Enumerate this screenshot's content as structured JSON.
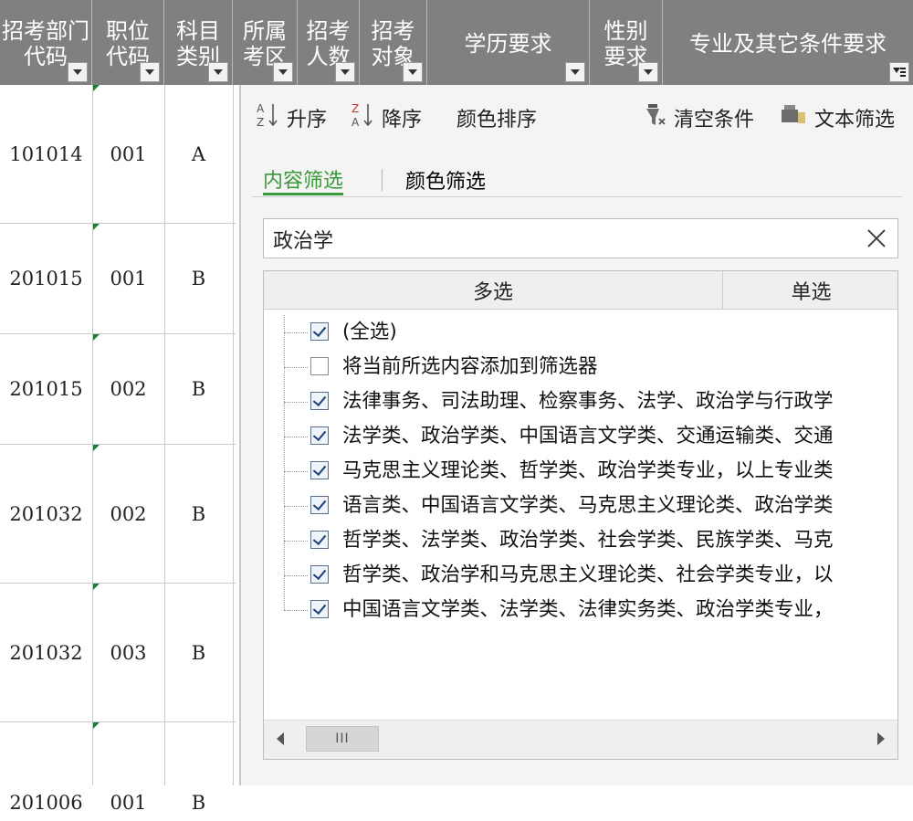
{
  "header": {
    "columns": [
      {
        "line1": "招考部门",
        "line2": "代码"
      },
      {
        "line1": "职位",
        "line2": "代码"
      },
      {
        "line1": "科目",
        "line2": "类别"
      },
      {
        "line1": "所属",
        "line2": "考区"
      },
      {
        "line1": "招考",
        "line2": "人数"
      },
      {
        "line1": "招考",
        "line2": "对象"
      },
      {
        "line1": "学历要求",
        "line2": ""
      },
      {
        "line1": "性别",
        "line2": "要求"
      },
      {
        "line1": "专业及其它条件要求",
        "line2": ""
      }
    ]
  },
  "grid": {
    "rows": [
      {
        "dept": "101014",
        "pos": "001",
        "subj": "A"
      },
      {
        "dept": "201015",
        "pos": "001",
        "subj": "B"
      },
      {
        "dept": "201015",
        "pos": "002",
        "subj": "B"
      },
      {
        "dept": "201032",
        "pos": "002",
        "subj": "B"
      },
      {
        "dept": "201032",
        "pos": "003",
        "subj": "B"
      },
      {
        "dept": "201006",
        "pos": "001",
        "subj": "B"
      }
    ]
  },
  "filter": {
    "sort_asc": "升序",
    "sort_desc": "降序",
    "sort_color": "颜色排序",
    "clear": "清空条件",
    "text_filter": "文本筛选",
    "tab_content": "内容筛选",
    "tab_color": "颜色筛选",
    "search_value": "政治学",
    "col_multi": "多选",
    "col_single": "单选",
    "items": [
      {
        "label": "(全选)",
        "checked": true
      },
      {
        "label": "将当前所选内容添加到筛选器",
        "checked": false
      },
      {
        "label": "法律事务、司法助理、检察事务、法学、政治学与行政学",
        "checked": true
      },
      {
        "label": "法学类、政治学类、中国语言文学类、交通运输类、交通",
        "checked": true
      },
      {
        "label": "马克思主义理论类、哲学类、政治学类专业，以上专业类",
        "checked": true
      },
      {
        "label": "语言类、中国语言文学类、马克思主义理论类、政治学类",
        "checked": true
      },
      {
        "label": "哲学类、法学类、政治学类、社会学类、民族学类、马克",
        "checked": true
      },
      {
        "label": "哲学类、政治学和马克思主义理论类、社会学类专业，以",
        "checked": true
      },
      {
        "label": "中国语言文学类、法学类、法律实务类、政治学类专业，",
        "checked": true
      }
    ],
    "scroll_thumb": "III"
  },
  "colors": {
    "header_bg": "#808080",
    "accent_green": "#3a9a3a",
    "panel_bg": "#f4f4f4"
  }
}
